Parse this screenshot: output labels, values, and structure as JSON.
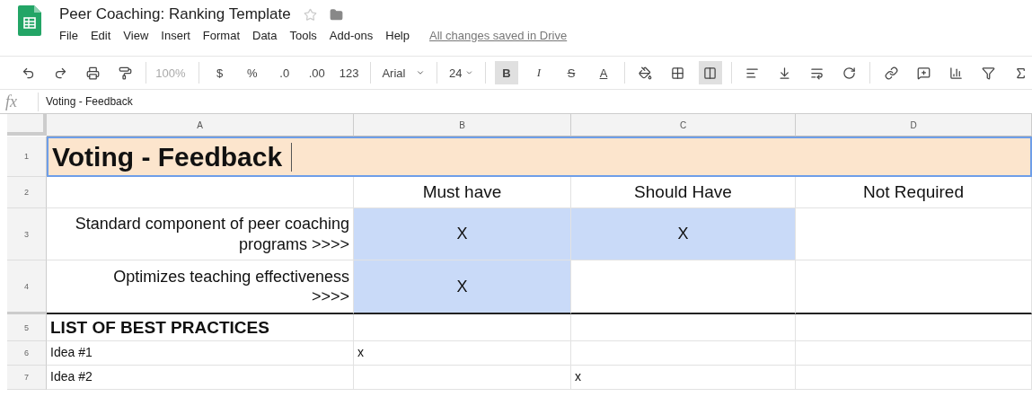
{
  "document": {
    "title": "Peer Coaching: Ranking Template",
    "starred": false
  },
  "menu": [
    "File",
    "Edit",
    "View",
    "Insert",
    "Format",
    "Data",
    "Tools",
    "Add-ons",
    "Help"
  ],
  "save_status": "All changes saved in Drive",
  "toolbar": {
    "zoom": "100%",
    "format_buttons": [
      "$",
      "%",
      ".0",
      ".00",
      "123"
    ],
    "font": "Arial",
    "font_size": "24",
    "style_buttons": [
      {
        "label": "B",
        "selected": true
      },
      {
        "label": "I",
        "selected": false
      },
      {
        "label": "S",
        "selected": false
      },
      {
        "label": "A",
        "selected": false
      }
    ],
    "merge_selected": true
  },
  "formula_bar": {
    "label": "fx",
    "value": "Voting - Feedback"
  },
  "columns": [
    "A",
    "B",
    "C",
    "D"
  ],
  "rows": [
    {
      "number": "1",
      "kind": "title",
      "border_below": false,
      "cells": [
        {
          "text": "Voting - Feedback",
          "selected": true,
          "color": "#fce5cd"
        }
      ]
    },
    {
      "number": "2",
      "kind": "header",
      "border_below": false,
      "cells": [
        null,
        {
          "text": "Must have"
        },
        {
          "text": "Should Have"
        },
        {
          "text": "Not Required"
        }
      ]
    },
    {
      "number": "3",
      "kind": "criterion",
      "border_below": false,
      "cells": [
        {
          "text": "Standard component of peer coaching programs >>>>"
        },
        {
          "text": "X",
          "color": "#c9daf8"
        },
        {
          "text": "X",
          "color": "#c9daf8"
        },
        null
      ]
    },
    {
      "number": "4",
      "kind": "criterion",
      "border_below": true,
      "cells": [
        {
          "text": "Optimizes teaching effectiveness >>>>"
        },
        {
          "text": "X",
          "color": "#c9daf8"
        },
        null,
        null
      ]
    },
    {
      "number": "5",
      "kind": "section",
      "border_below": false,
      "cells": [
        {
          "text": "LIST OF BEST PRACTICES"
        },
        null,
        null,
        null
      ]
    },
    {
      "number": "6",
      "kind": "idea",
      "border_below": false,
      "cells": [
        {
          "text": "Idea #1"
        },
        {
          "text": "x"
        },
        null,
        null
      ]
    },
    {
      "number": "7",
      "kind": "idea",
      "border_below": false,
      "cells": [
        {
          "text": "Idea #2"
        },
        null,
        {
          "text": "x"
        },
        null
      ]
    }
  ]
}
